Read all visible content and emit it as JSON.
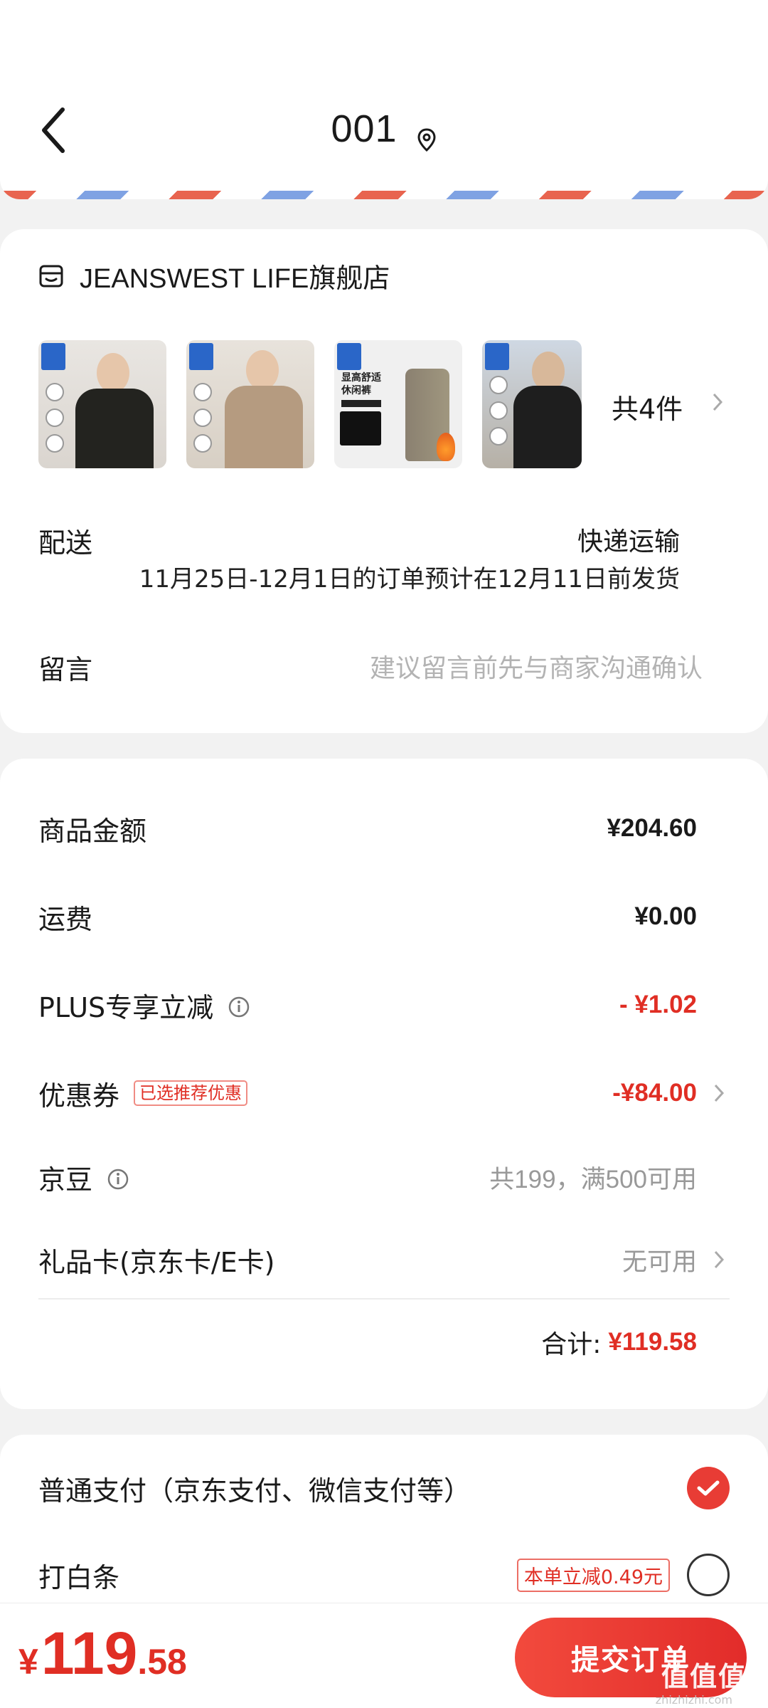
{
  "header": {
    "title": "001"
  },
  "store": {
    "name": "JEANSWEST LIFE旗舰店",
    "thumb3_text": "显高舒适\n休闲裤",
    "items_count": "共4件"
  },
  "delivery": {
    "label": "配送",
    "method": "快递运输",
    "notice": "11月25日-12月1日的订单预计在12月11日前发货"
  },
  "message": {
    "label": "留言",
    "placeholder": "建议留言前先与商家沟通确认"
  },
  "amounts": {
    "goods_label": "商品金额",
    "goods_value": "¥204.60",
    "shipping_label": "运费",
    "shipping_value": "¥0.00",
    "plus_label": "PLUS专享立减",
    "plus_value": "- ¥1.02",
    "coupon_label": "优惠券",
    "coupon_tag": "已选推荐优惠",
    "coupon_value": "-¥84.00",
    "jingdou_label": "京豆",
    "jingdou_value": "共199，满500可用",
    "giftcard_label": "礼品卡(京东卡/E卡)",
    "giftcard_value": "无可用",
    "subtotal_label": "合计:",
    "subtotal_value": "¥119.58"
  },
  "payment": {
    "normal_label": "普通支付（京东支付、微信支付等）",
    "normal_selected": true,
    "baitiao_label": "打白条",
    "baitiao_promo": "本单立减0.49元",
    "baitiao_selected": false
  },
  "bottom": {
    "currency": "¥",
    "total_int": "119",
    "total_dec": ".58",
    "submit_label": "提交订单",
    "watermark": "值值值",
    "watermark_sub": "zhizhizhi.com"
  },
  "colors": {
    "accent_red": "#e02e24",
    "airmail_red": "#e8644f",
    "airmail_blue": "#7fa2e3"
  }
}
